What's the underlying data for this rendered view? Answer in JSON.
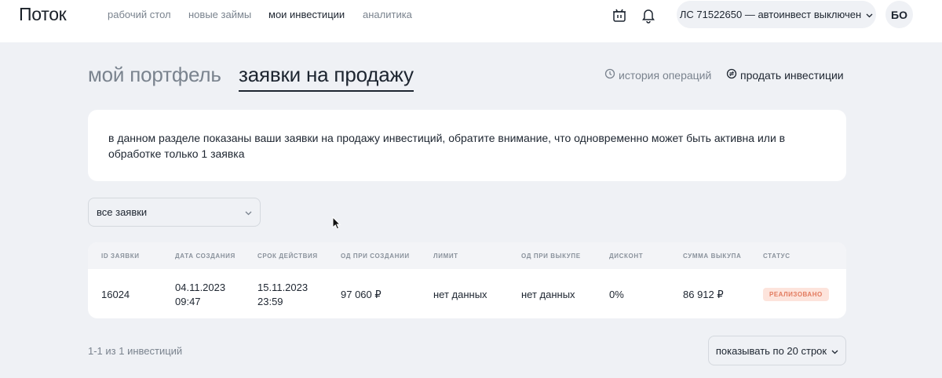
{
  "header": {
    "logo": "Поток",
    "nav": [
      {
        "label": "рабочий стол"
      },
      {
        "label": "новые займы"
      },
      {
        "label": "мои инвестиции"
      },
      {
        "label": "аналитика"
      }
    ],
    "account": "ЛС 71522650 — автоинвест выключен",
    "avatar": "БО",
    "icons": [
      "basket-icon",
      "bell-icon",
      "chevron-down-icon"
    ]
  },
  "tabs": {
    "portfolio": "мой портфель",
    "sale_requests": "заявки на продажу"
  },
  "links": {
    "history": "история операций",
    "sell": "продать инвестиции"
  },
  "info": {
    "text": "в данном разделе показаны ваши заявки на продажу инвестиций, обратите внимание, что одновременно может быть активна или в обработке только 1 заявка"
  },
  "filter": {
    "value": "все заявки"
  },
  "table": {
    "columns": [
      "ID заявки",
      "дата создания",
      "срок действия",
      "ОД при создании",
      "лимит",
      "ОД при выкупе",
      "дисконт",
      "сумма выкупа",
      "статус"
    ],
    "rows": [
      {
        "id": "16024",
        "created_date": "04.11.2023",
        "created_time": "09:47",
        "expiry_date": "15.11.2023",
        "expiry_time": "23:59",
        "principal_created": "97 060 ₽",
        "limit": "нет данных",
        "principal_buyback": "нет данных",
        "discount": "0%",
        "buyback_sum": "86 912 ₽",
        "status": "реализовано"
      }
    ]
  },
  "footer": {
    "count": "1-1 из 1 инвестиций",
    "rows_per_page": "показывать по 20 строк"
  },
  "colors": {
    "background": "#eff1f5",
    "text": "#1d2530",
    "muted": "#7a838e",
    "status_bg": "#fde4dc",
    "status_fg": "#e27a5e"
  }
}
